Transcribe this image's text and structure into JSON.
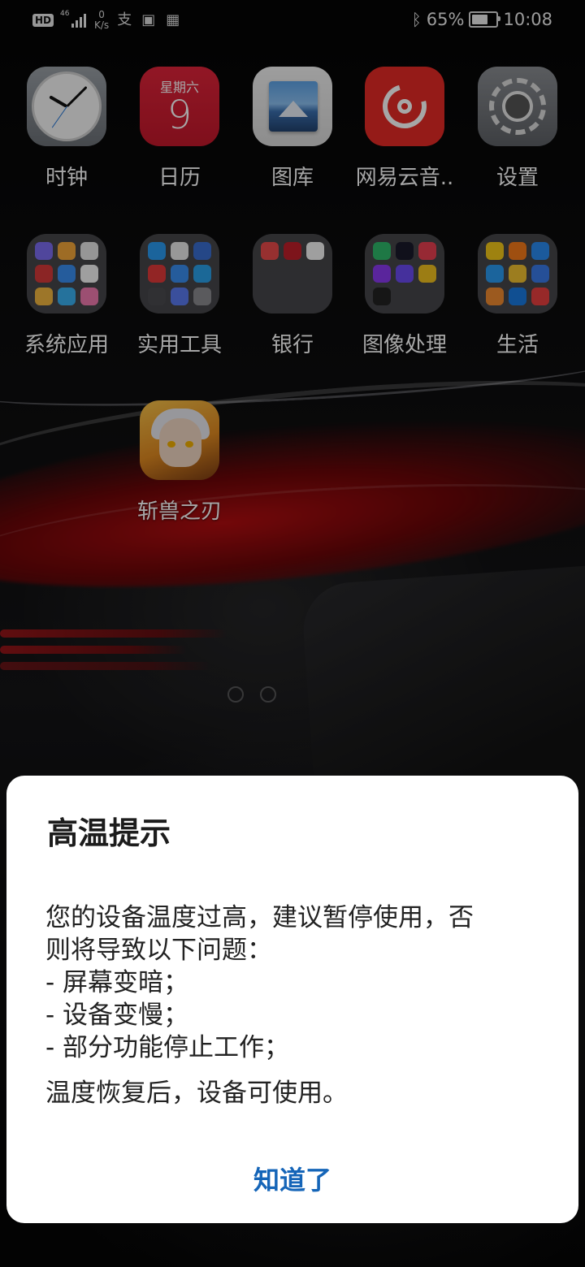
{
  "status_bar": {
    "hd": "HD",
    "network": "46",
    "speed_value": "0",
    "speed_unit": "K/s",
    "battery_percent": "65%",
    "battery_level": 0.65,
    "time": "10:08"
  },
  "apps_row1": [
    {
      "label": "时钟",
      "icon": "clock-icon"
    },
    {
      "label": "日历",
      "icon": "calendar-icon",
      "weekday": "星期六",
      "day": "9"
    },
    {
      "label": "图库",
      "icon": "gallery-icon"
    },
    {
      "label": "网易云音..",
      "icon": "netease-music-icon"
    },
    {
      "label": "设置",
      "icon": "settings-icon"
    }
  ],
  "folders_row2": [
    {
      "label": "系统应用"
    },
    {
      "label": "实用工具"
    },
    {
      "label": "银行"
    },
    {
      "label": "图像处理"
    },
    {
      "label": "生活"
    }
  ],
  "apps_row3": [
    {
      "label": "斩兽之刃",
      "icon": "game-icon"
    }
  ],
  "dialog": {
    "title": "高温提示",
    "body_line1": "您的设备温度过高，建议暂停使用，否",
    "body_line2": "则将导致以下问题：",
    "item1": "- 屏幕变暗；",
    "item2": "- 设备变慢；",
    "item3": "- 部分功能停止工作；",
    "footer": "温度恢复后，设备可使用。",
    "button": "知道了"
  },
  "colors": {
    "dialog_button": "#1565b8",
    "calendar_red": "#d21f34",
    "music_red": "#e52a25"
  }
}
